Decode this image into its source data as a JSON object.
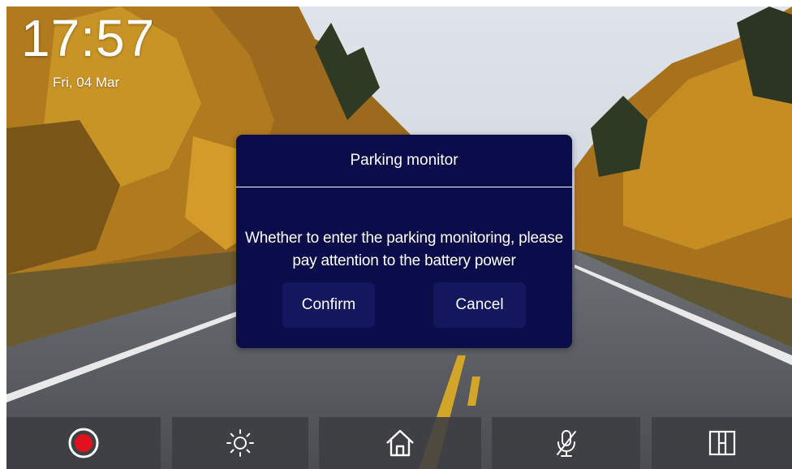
{
  "status": {
    "time": "17:57",
    "date": "Fri, 04 Mar"
  },
  "dialog": {
    "title": "Parking monitor",
    "message_line1": "Whether to enter the parking monitoring, please",
    "message_line2": "pay attention to the battery power",
    "confirm_label": "Confirm",
    "cancel_label": "Cancel"
  },
  "bottom_bar": {
    "items": [
      {
        "icon": "record-icon"
      },
      {
        "icon": "brightness-icon"
      },
      {
        "icon": "home-icon"
      },
      {
        "icon": "mic-off-icon"
      },
      {
        "icon": "split-screen-icon"
      }
    ]
  },
  "colors": {
    "dialog_bg": "#0b0c4a",
    "button_bg": "#13175e",
    "record_red": "#e3101e",
    "bar_bg": "#3c3e42"
  }
}
